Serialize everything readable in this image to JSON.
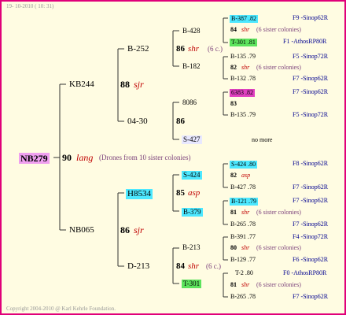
{
  "header": {
    "date": "19- 10-2010 ( 10: 31)"
  },
  "footer": {
    "copyright": "Copyright 2004-2010 @ Karl Kehrle Foundation."
  },
  "root": {
    "id": "NB279",
    "num": "90",
    "tag": "lang",
    "note": "(Drones from 10 sister colonies)"
  },
  "gen1": [
    {
      "id": "KB244",
      "num": "88",
      "tag": "sjr"
    },
    {
      "id": "NB065",
      "num": "86",
      "tag": "sjr"
    }
  ],
  "gen2": [
    {
      "id": "B-252",
      "num": "86",
      "tag": "shr",
      "note": "(6 c.)"
    },
    {
      "id": "04-30",
      "num": "86",
      "tag": "",
      "note": ""
    },
    {
      "id": "H8534",
      "num": "85",
      "tag": "asp",
      "note": ""
    },
    {
      "id": "D-213",
      "num": "84",
      "tag": "shr",
      "note": "(6 c.)"
    }
  ],
  "gen3": [
    {
      "id": "B-428"
    },
    {
      "id": "B-182"
    },
    {
      "id": "8086"
    },
    {
      "id": "S-427"
    },
    {
      "id": "S-424"
    },
    {
      "id": "B-379"
    },
    {
      "id": "B-213"
    },
    {
      "id": "T-301"
    }
  ],
  "gen4": [
    {
      "id": "B-387 .82",
      "src": "F9 -Sinop62R",
      "num": "84",
      "tag": "shr",
      "note": "(6 sister colonies)",
      "id2": "T-301 .81",
      "src2": "F1 -AthosRP80R"
    },
    {
      "id": "B-135 .79",
      "src": "F5 -Sinop72R",
      "num": "82",
      "tag": "shr",
      "note": "(6 sister colonies)",
      "id2": "B-132 .78",
      "src2": "F7 -Sinop62R"
    },
    {
      "id": "6383 .82",
      "src": "F7 -Sinop62R",
      "num": "83",
      "tag": "",
      "note": "",
      "id2": "B-135 .79",
      "src2": "F5 -Sinop72R"
    },
    {
      "id": "",
      "src": "",
      "num": "",
      "tag": "",
      "note": "no more",
      "id2": "",
      "src2": ""
    },
    {
      "id": "S-424 .80",
      "src": "F8 -Sinop62R",
      "num": "82",
      "tag": "asp",
      "note": "",
      "id2": "B-427 .78",
      "src2": "F7 -Sinop62R"
    },
    {
      "id": "B-121 .79",
      "src": "F7 -Sinop62R",
      "num": "81",
      "tag": "shr",
      "note": "(6 sister colonies)",
      "id2": "B-265 .78",
      "src2": "F7 -Sinop62R"
    },
    {
      "id": "B-391 .77",
      "src": "F4 -Sinop72R",
      "num": "80",
      "tag": "shr",
      "note": "(6 sister colonies)",
      "id2": "B-129 .77",
      "src2": "F6 -Sinop62R"
    },
    {
      "id": "T-2 .80",
      "src": "F0 -AthosRP80R",
      "num": "81",
      "tag": "shr",
      "note": "(6 sister colonies)",
      "id2": "B-265 .78",
      "src2": "F7 -Sinop62R"
    }
  ]
}
